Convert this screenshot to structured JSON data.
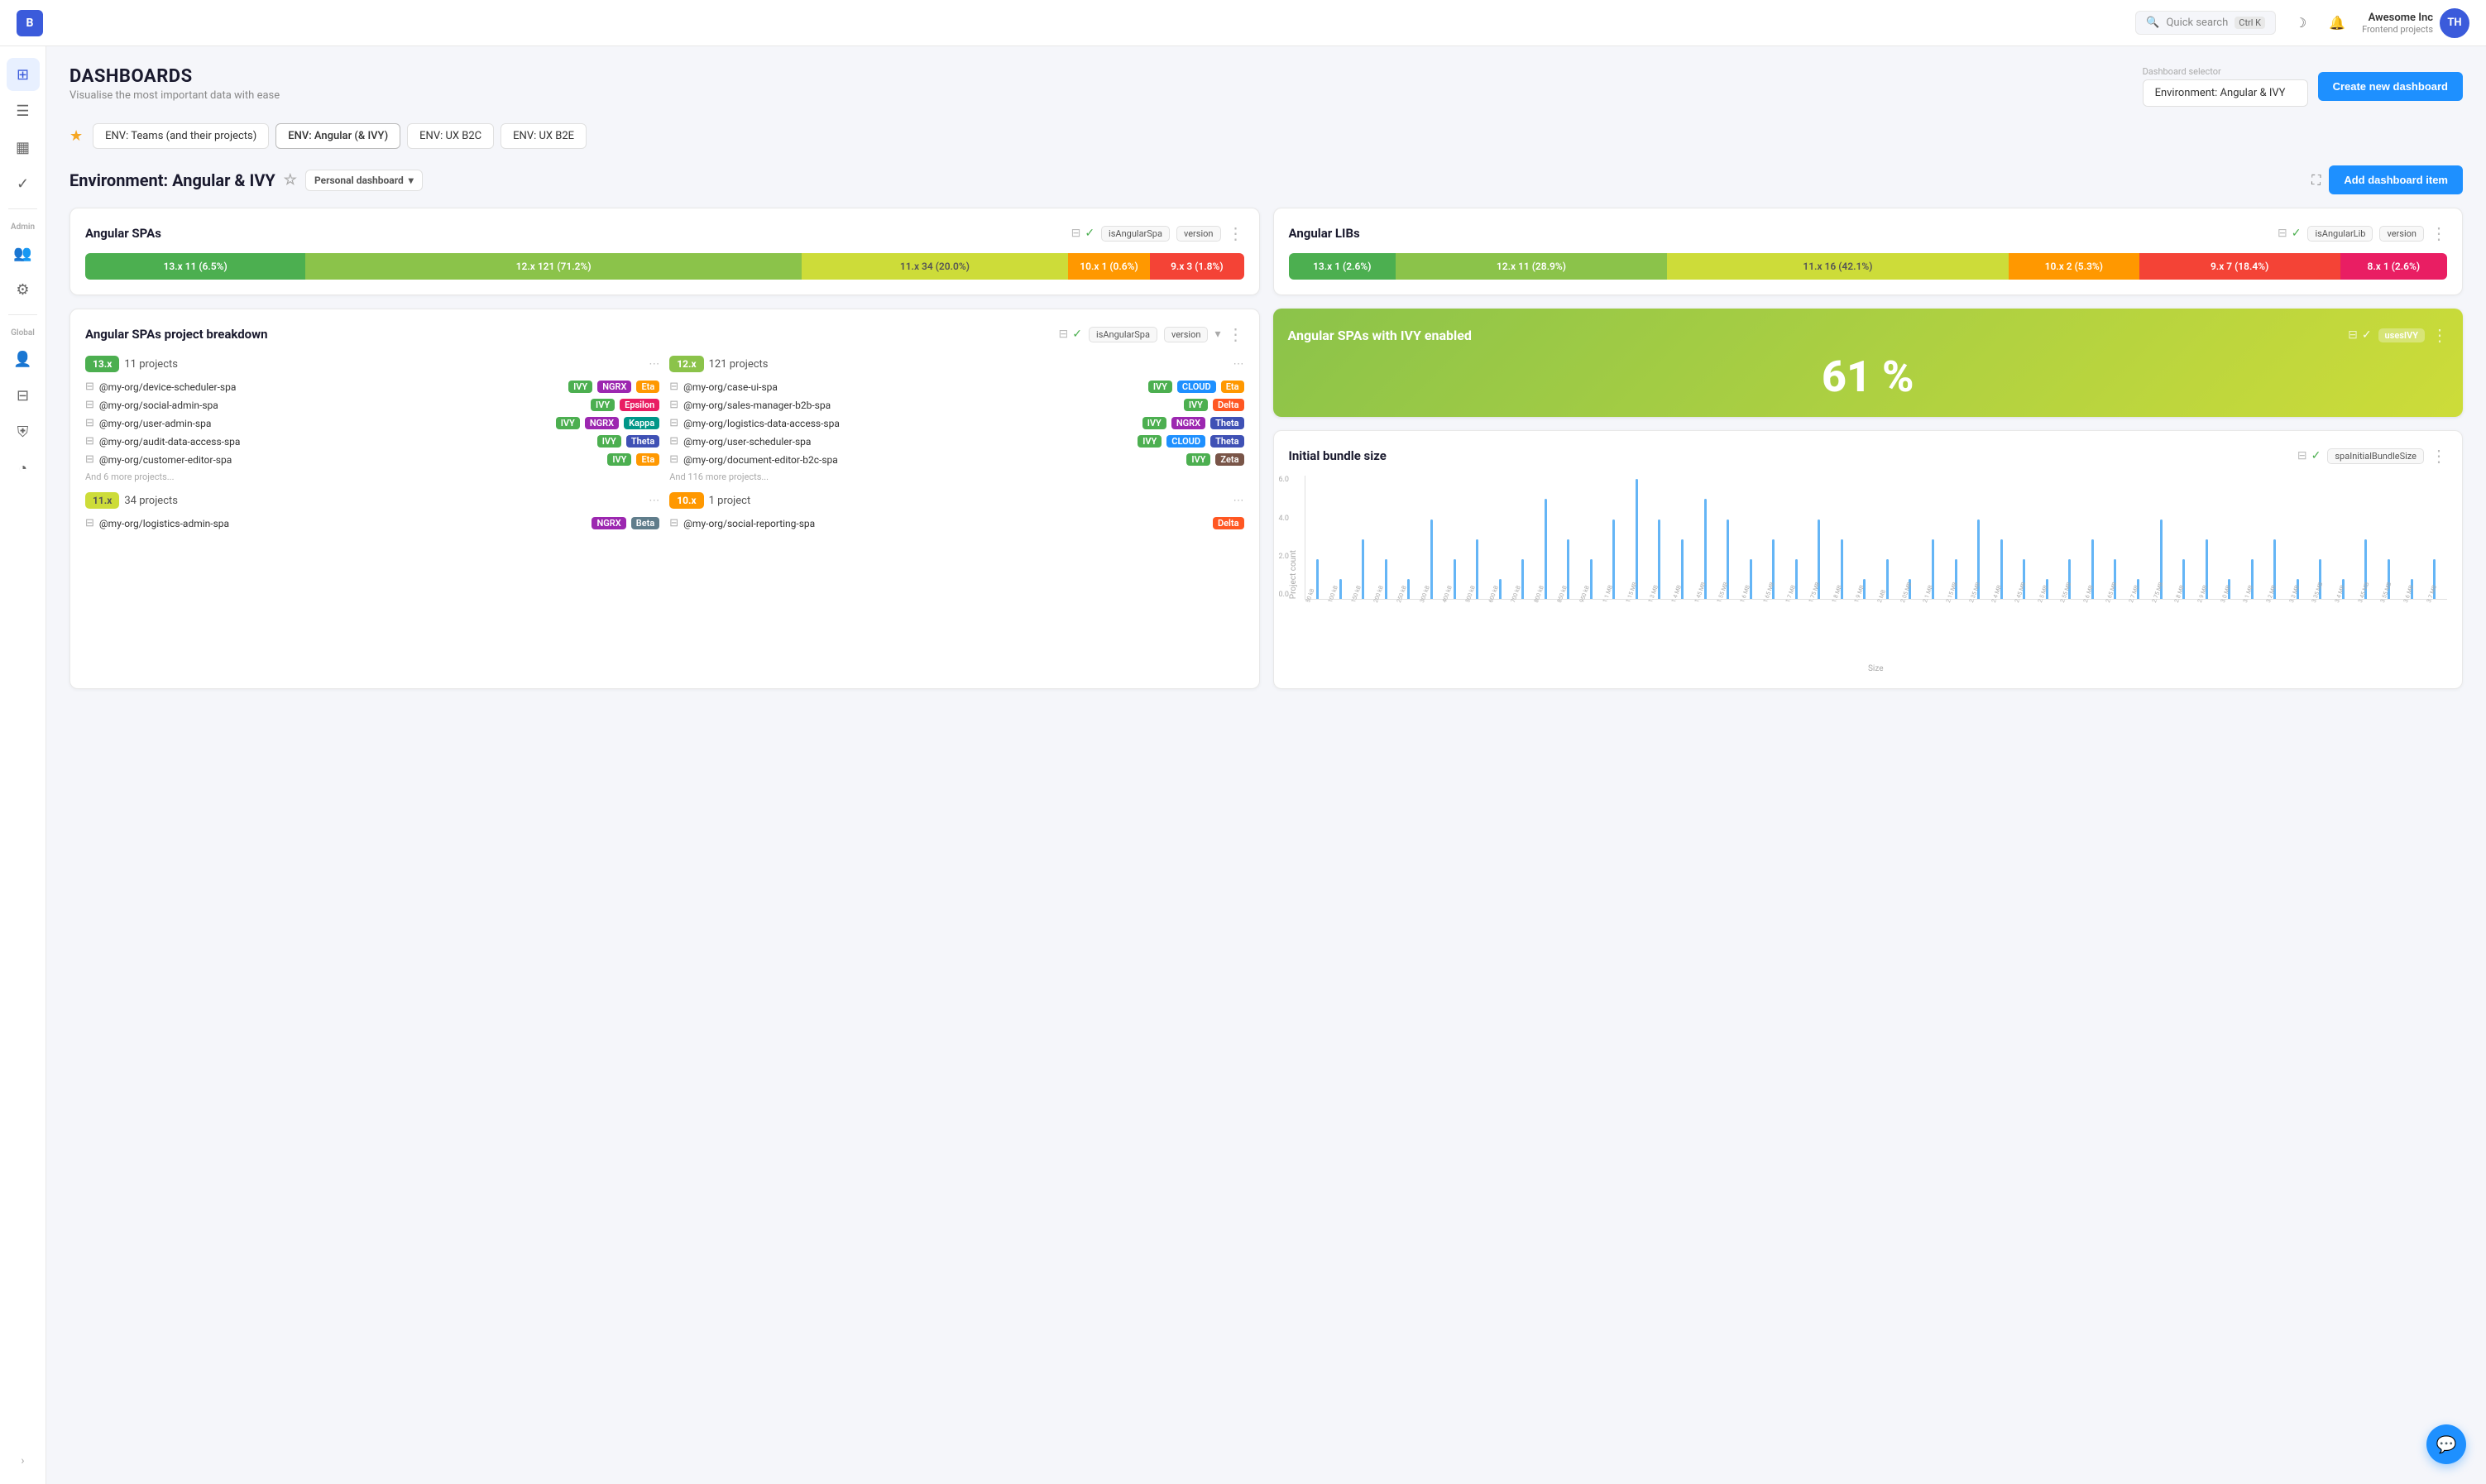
{
  "navbar": {
    "logo": "B",
    "search_placeholder": "Quick search",
    "search_shortcut": "Ctrl K",
    "user_name": "Awesome Inc",
    "user_subtitle": "Frontend projects",
    "user_initials": "TH"
  },
  "sidebar": {
    "admin_label": "Admin",
    "global_label": "Global",
    "items": [
      {
        "name": "dashboard",
        "icon": "⊞",
        "active": true
      },
      {
        "name": "list",
        "icon": "☰"
      },
      {
        "name": "calendar",
        "icon": "▦"
      },
      {
        "name": "check",
        "icon": "✓"
      },
      {
        "name": "users",
        "icon": "👥"
      },
      {
        "name": "table",
        "icon": "⊟"
      },
      {
        "name": "shield",
        "icon": "⛨"
      },
      {
        "name": "clock",
        "icon": "◔"
      }
    ]
  },
  "page": {
    "title": "DASHBOARDS",
    "subtitle": "Visualise the most important data with ease"
  },
  "dashboard_selector": {
    "label": "Dashboard selector",
    "value": "Environment: Angular & IVY"
  },
  "buttons": {
    "create_dashboard": "Create new dashboard",
    "add_dashboard_item": "Add dashboard item"
  },
  "tabs": [
    {
      "label": "ENV: Teams (and their projects)",
      "active": false
    },
    {
      "label": "ENV: Angular (& IVY)",
      "active": false
    },
    {
      "label": "ENV: UX B2C",
      "active": false
    },
    {
      "label": "ENV: UX B2E",
      "active": false
    }
  ],
  "dashboard": {
    "title": "Environment: Angular & IVY",
    "personal_badge": "Personal dashboard"
  },
  "widgets": {
    "angular_spas": {
      "title": "Angular SPAs",
      "tag1": "isAngularSpa",
      "tag2": "version",
      "versions": [
        {
          "label": "13.x",
          "count": "11 (6.5%)",
          "class": "v13",
          "width": 18
        },
        {
          "label": "12.x",
          "count": "121 (71.2%)",
          "class": "v12",
          "width": 42
        },
        {
          "label": "11.x",
          "count": "34 (20.0%)",
          "class": "v11",
          "width": 22
        },
        {
          "label": "10.x",
          "count": "1 (0.6%)",
          "class": "v10",
          "width": 6
        },
        {
          "label": "9.x",
          "count": "3 (1.8%)",
          "class": "v9",
          "width": 7
        },
        {
          "label": "",
          "count": "",
          "class": "v8",
          "width": 5
        }
      ]
    },
    "angular_libs": {
      "title": "Angular LIBs",
      "tag1": "isAngularLib",
      "tag2": "version",
      "versions": [
        {
          "label": "13.x",
          "count": "1 (2.6%)",
          "class": "v13",
          "width": 8
        },
        {
          "label": "12.x",
          "count": "11 (28.9%)",
          "class": "v12",
          "width": 22
        },
        {
          "label": "11.x",
          "count": "16 (42.1%)",
          "class": "v11",
          "width": 28
        },
        {
          "label": "10.x",
          "count": "2 (5.3%)",
          "class": "v10",
          "width": 10
        },
        {
          "label": "9.x",
          "count": "7 (18.4%)",
          "class": "v9",
          "width": 16
        },
        {
          "label": "8.x",
          "count": "1 (2.6%)",
          "class": "v8",
          "width": 8
        }
      ]
    },
    "breakdown": {
      "title": "Angular SPAs project breakdown",
      "tag1": "isAngularSpa",
      "tag2": "version",
      "columns": [
        {
          "version": "13.x",
          "version_class": "v13",
          "count": "11 projects",
          "projects": [
            {
              "name": "@my-org/device-scheduler-spa",
              "tags": [
                "IVY",
                "NGRX",
                "Eta"
              ]
            },
            {
              "name": "@my-org/social-admin-spa",
              "tags": [
                "IVY",
                "Epsilon"
              ]
            },
            {
              "name": "@my-org/user-admin-spa",
              "tags": [
                "IVY",
                "NGRX",
                "Kappa"
              ]
            },
            {
              "name": "@my-org/audit-data-access-spa",
              "tags": [
                "IVY",
                "Theta"
              ]
            },
            {
              "name": "@my-org/customer-editor-spa",
              "tags": [
                "IVY",
                "Eta"
              ]
            }
          ],
          "more": "And 6 more projects..."
        },
        {
          "version": "12.x",
          "version_class": "v12",
          "count": "121 projects",
          "projects": [
            {
              "name": "@my-org/case-ui-spa",
              "tags": [
                "IVY",
                "CLOUD",
                "Eta"
              ]
            },
            {
              "name": "@my-org/sales-manager-b2b-spa",
              "tags": [
                "IVY",
                "Delta"
              ]
            },
            {
              "name": "@my-org/logistics-data-access-spa",
              "tags": [
                "IVY",
                "NGRX",
                "Theta"
              ]
            },
            {
              "name": "@my-org/user-scheduler-spa",
              "tags": [
                "IVY",
                "CLOUD",
                "Theta"
              ]
            },
            {
              "name": "@my-org/document-editor-b2c-spa",
              "tags": [
                "IVY",
                "Zeta"
              ]
            }
          ],
          "more": "And 116 more projects..."
        },
        {
          "version": "11.x",
          "version_class": "v11",
          "count": "34 projects",
          "projects": [
            {
              "name": "@my-org/logistics-admin-spa",
              "tags": [
                "NGRX",
                "Beta"
              ]
            }
          ],
          "more": ""
        },
        {
          "version": "10.x",
          "version_class": "v10",
          "count": "1 project",
          "projects": [
            {
              "name": "@my-org/social-reporting-spa",
              "tags": [
                "Delta"
              ]
            }
          ],
          "more": ""
        }
      ]
    },
    "ivy_enabled": {
      "title": "Angular SPAs with IVY enabled",
      "tag": "usesIVY",
      "percent": "61 %"
    },
    "bundle_size": {
      "title": "Initial bundle size",
      "tag": "spaInitialBundleSize",
      "y_label": "Project count",
      "x_label": "Size",
      "y_ticks": [
        "6.0",
        "4.0",
        "2.0",
        "0.0"
      ],
      "bars": [
        2,
        1,
        3,
        2,
        1,
        4,
        2,
        3,
        1,
        2,
        5,
        3,
        2,
        4,
        6,
        4,
        3,
        5,
        4,
        2,
        3,
        2,
        4,
        3,
        1,
        2,
        1,
        3,
        2,
        4,
        3,
        2,
        1,
        2,
        3,
        2,
        1,
        4,
        2,
        3,
        1,
        2,
        3,
        1,
        2,
        1,
        3,
        2,
        1,
        2
      ],
      "x_labels": [
        "50 kB",
        "100 kB",
        "150 kB",
        "200 kB",
        "250 kB",
        "300 kB",
        "400 kB",
        "500 kB",
        "600 kB",
        "700 kB",
        "800 kB",
        "850 kB",
        "950 kB",
        "1.1 MB",
        "1.15 MB",
        "1.3 MB",
        "1.4 MB",
        "1.45 MB",
        "1.55 MB",
        "1.6 MB",
        "1.65 MB",
        "1.7 MB",
        "1.75 MB",
        "1.8 MB",
        "1.9 MB",
        "2 MB",
        "2.05 MB",
        "2.1 MB",
        "2.15 MB",
        "2.35 MB",
        "2.4 MB",
        "2.45 MB",
        "2.5 MB",
        "2.55 MB",
        "2.6 MB",
        "2.65 MB",
        "2.7 MB",
        "2.75 MB",
        "2.8 MB",
        "2.9 MB",
        "3.0 MB",
        "3.1 MB",
        "3.2 MB",
        "3.3 MB",
        "3.35 MB",
        "3.4 MB",
        "3.45 MB",
        "3.55 MB",
        "3.6 MB",
        "3.7 MB"
      ]
    }
  },
  "chat_icon": "💬"
}
